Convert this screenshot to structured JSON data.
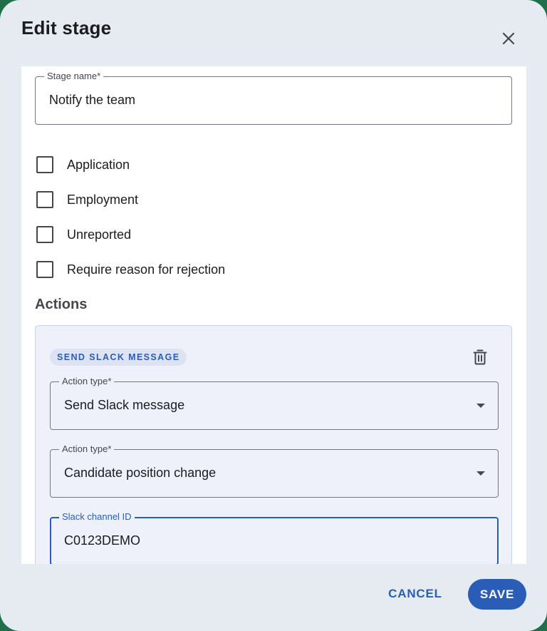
{
  "dialog": {
    "title": "Edit stage",
    "close_icon": "close-icon"
  },
  "form": {
    "stage_name": {
      "label": "Stage name*",
      "value": "Notify the team"
    },
    "checkboxes": [
      {
        "label": "Application",
        "checked": false
      },
      {
        "label": "Employment",
        "checked": false
      },
      {
        "label": "Unreported",
        "checked": false
      },
      {
        "label": "Require reason for rejection",
        "checked": false
      }
    ],
    "actions_title": "Actions",
    "action": {
      "chip": "SEND SLACK MESSAGE",
      "delete_icon": "trash-icon",
      "action_type": {
        "label": "Action type*",
        "value": "Send Slack message"
      },
      "trigger_type": {
        "label": "Action type*",
        "value": "Candidate position change"
      },
      "slack_channel": {
        "label": "Slack channel ID",
        "value": "C0123DEMO"
      }
    }
  },
  "footer": {
    "cancel_label": "CANCEL",
    "save_label": "SAVE"
  },
  "colors": {
    "accent": "#2a5db8",
    "dialog_bg": "#e6ebf1",
    "card_bg": "#eff1fa"
  }
}
